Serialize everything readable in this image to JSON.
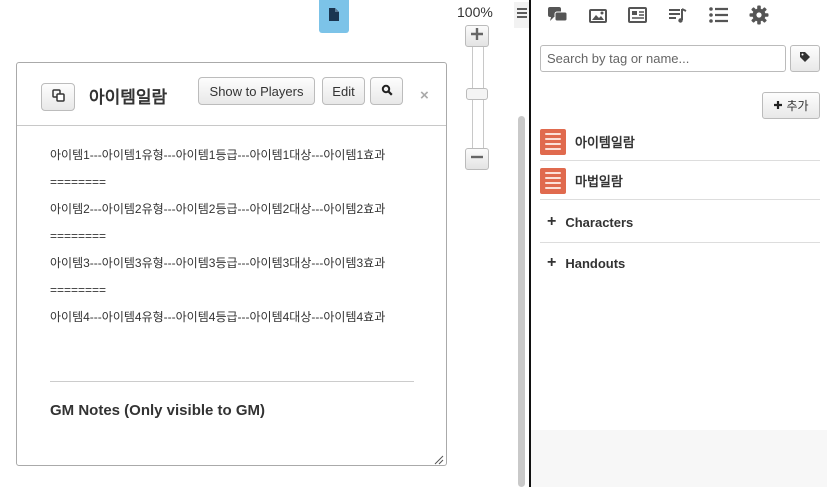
{
  "toolbar": {
    "page_icon": "document-icon"
  },
  "dialog": {
    "title": "아이템일람",
    "copy_icon": "copy-icon",
    "show_to_players_label": "Show to Players",
    "edit_label": "Edit",
    "search_icon": "magnifier-icon",
    "close_glyph": "×",
    "body_lines": [
      "아이템1---아이템1유형---아이템1등급---아이템1대상---아이템1효과",
      "========",
      "아이템2---아이템2유형---아이템2등급---아이템2대상---아이템2효과",
      "========",
      "아이템3---아이템3유형---아이템3등급---아이템3대상---아이템3효과",
      "========",
      "아이템4---아이템4유형---아이템4등급---아이템4대상---아이템4효과"
    ],
    "gm_notes_label": "GM Notes (Only visible to GM)"
  },
  "zoom": {
    "level": "100%",
    "level_fraction": 0.55
  },
  "sidebar": {
    "tabs": [
      {
        "icon": "chat-icon"
      },
      {
        "icon": "art-library-icon"
      },
      {
        "icon": "journal-icon"
      },
      {
        "icon": "jukebox-icon"
      },
      {
        "icon": "list-icon"
      },
      {
        "icon": "settings-gear-icon"
      }
    ],
    "search_placeholder": "Search by tag or name...",
    "tag_icon": "tag-icon",
    "add_label": "추가",
    "items": [
      {
        "label": "아이템일람",
        "icon": "handout-icon"
      },
      {
        "label": "마법일람",
        "icon": "handout-icon"
      }
    ],
    "folders": [
      {
        "label": "Characters"
      },
      {
        "label": "Handouts"
      }
    ]
  },
  "colors": {
    "page_tab": "#7cc3e8",
    "handout_icon": "#e06a4e",
    "sidebar_icon": "#555555"
  }
}
